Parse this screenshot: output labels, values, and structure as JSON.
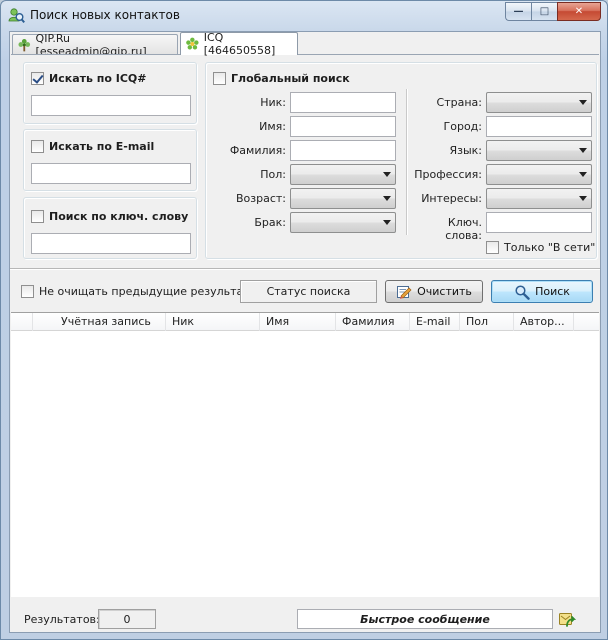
{
  "window": {
    "title": "Поиск новых контактов",
    "min_symbol": "—",
    "max_symbol": "□",
    "close_symbol": "✕"
  },
  "tabs": [
    {
      "label": "QIP.Ru [esseadmin@qip.ru]",
      "active": false
    },
    {
      "label": "ICQ [464650558]",
      "active": true
    }
  ],
  "left": {
    "by_icq_label": "Искать по ICQ#",
    "by_icq_checked": true,
    "icq_value": "",
    "by_email_label": "Искать по E-mail",
    "by_email_checked": false,
    "email_value": "",
    "by_keyword_label": "Поиск по ключ. слову",
    "by_keyword_checked": false,
    "keyword_value": ""
  },
  "global": {
    "label": "Глобальный поиск",
    "checked": false,
    "fields_left": [
      {
        "label": "Ник:",
        "kind": "text",
        "value": ""
      },
      {
        "label": "Имя:",
        "kind": "text",
        "value": ""
      },
      {
        "label": "Фамилия:",
        "kind": "text",
        "value": ""
      },
      {
        "label": "Пол:",
        "kind": "combo",
        "value": ""
      },
      {
        "label": "Возраст:",
        "kind": "combo",
        "value": ""
      },
      {
        "label": "Брак:",
        "kind": "combo",
        "value": ""
      }
    ],
    "fields_right": [
      {
        "label": "Страна:",
        "kind": "combo",
        "value": ""
      },
      {
        "label": "Город:",
        "kind": "text",
        "value": ""
      },
      {
        "label": "Язык:",
        "kind": "combo",
        "value": ""
      },
      {
        "label": "Профессия:",
        "kind": "combo",
        "value": ""
      },
      {
        "label": "Интересы:",
        "kind": "combo",
        "value": ""
      },
      {
        "label": "Ключ. слова:",
        "kind": "text",
        "value": ""
      }
    ],
    "online_only_label": "Только \"В сети\"",
    "online_only_checked": false
  },
  "actions": {
    "keep_results_label": "Не очищать предыдущие результаты",
    "keep_results_checked": false,
    "status_text": "Статус поиска",
    "clear_label": "Очистить",
    "search_label": "Поиск"
  },
  "results_table": {
    "columns": [
      "",
      "Учётная запись",
      "Ник",
      "Имя",
      "Фамилия",
      "E-mail",
      "Пол",
      "Автор..."
    ],
    "rows": []
  },
  "statusbar": {
    "results_label": "Результатов:",
    "results_count": "0",
    "quick_message": "Быстрое сообщение"
  },
  "colors": {
    "accent": "#3c7fb1",
    "window_frame": "#bfcfe3",
    "close_button": "#c54a33"
  }
}
